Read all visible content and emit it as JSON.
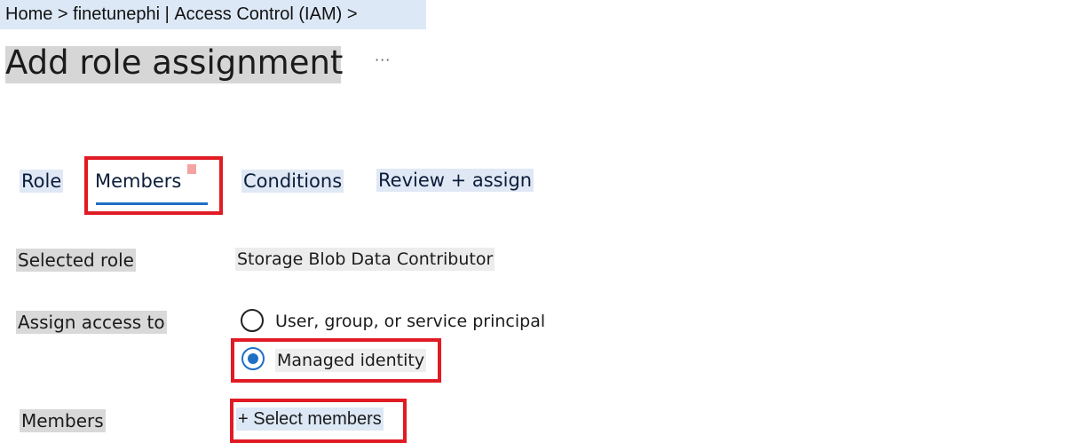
{
  "breadcrumb": {
    "home": "Home",
    "separator": " > ",
    "resource": "finetunephi",
    "divider": " | ",
    "section": "Access Control (IAM)",
    "trail_end": " >"
  },
  "page": {
    "title": "Add role assignment",
    "more_label": "···"
  },
  "tabs": [
    {
      "label": "Role"
    },
    {
      "label": "Members",
      "active": true
    },
    {
      "label": "Conditions"
    },
    {
      "label": "Review + assign"
    }
  ],
  "form": {
    "selected_role_label": "Selected role",
    "selected_role_value": "Storage Blob Data Contributor",
    "assign_access_label": "Assign access to",
    "assign_options": [
      {
        "label": "User, group, or service principal",
        "selected": false
      },
      {
        "label": "Managed identity",
        "selected": true
      }
    ],
    "members_label": "Members",
    "select_members_label": "+ Select members"
  },
  "colors": {
    "accent": "#1f6fc5",
    "highlight": "#e01b24"
  }
}
